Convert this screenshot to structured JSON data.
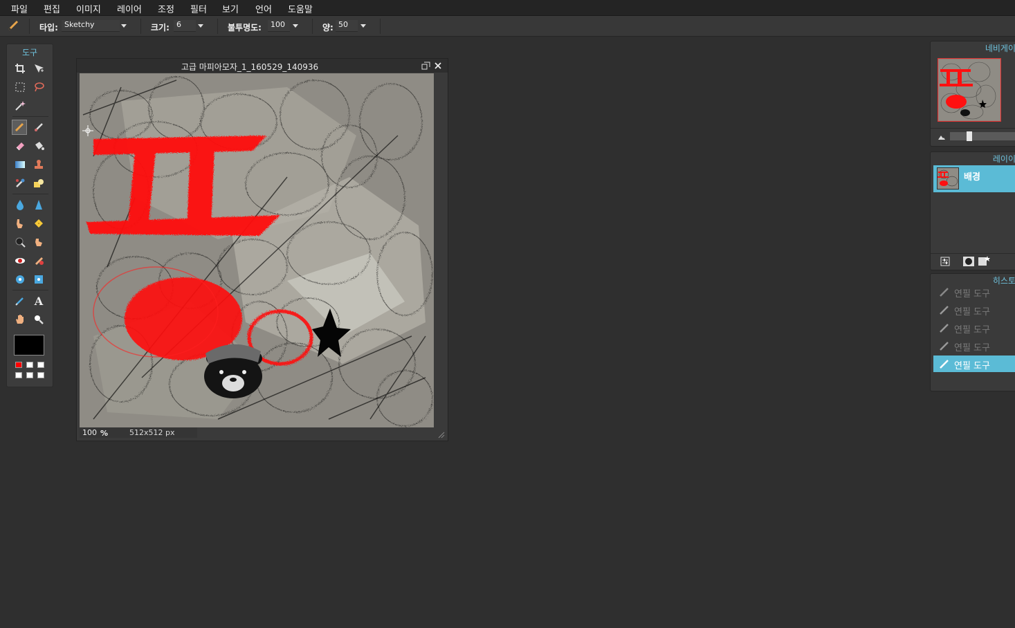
{
  "menu": [
    "파일",
    "편집",
    "이미지",
    "레이어",
    "조정",
    "필터",
    "보기",
    "언어",
    "도움말"
  ],
  "options": {
    "type_label": "타입:",
    "type_value": "Sketchy",
    "size_label": "크기:",
    "size_value": "6",
    "opacity_label": "불투명도:",
    "opacity_value": "100",
    "amount_label": "양:",
    "amount_value": "50"
  },
  "tools": {
    "title": "도구",
    "fg_color": "#000000",
    "swatches": [
      "#ff0000",
      "#ffffff",
      "#ffffff",
      "#ffffff",
      "#ffffff",
      "#ffffff"
    ]
  },
  "document": {
    "title": "고급 마피아모자_1_160529_140936",
    "zoom": "100",
    "zoom_unit": "%",
    "dimensions": "512x512 px"
  },
  "navigator": {
    "title": "네비게이"
  },
  "layers": {
    "title": "레이이",
    "items": [
      {
        "name": "배경",
        "selected": true
      }
    ]
  },
  "history": {
    "title": "히스토",
    "items": [
      "연필 도구",
      "연필 도구",
      "연필 도구",
      "연필 도구",
      "연필 도구"
    ],
    "selected_index": 4
  },
  "colors": {
    "accent": "#6fc3de",
    "selection": "#5bbbd6",
    "background": "#2f2f2f",
    "panel": "#3a3a3a"
  }
}
